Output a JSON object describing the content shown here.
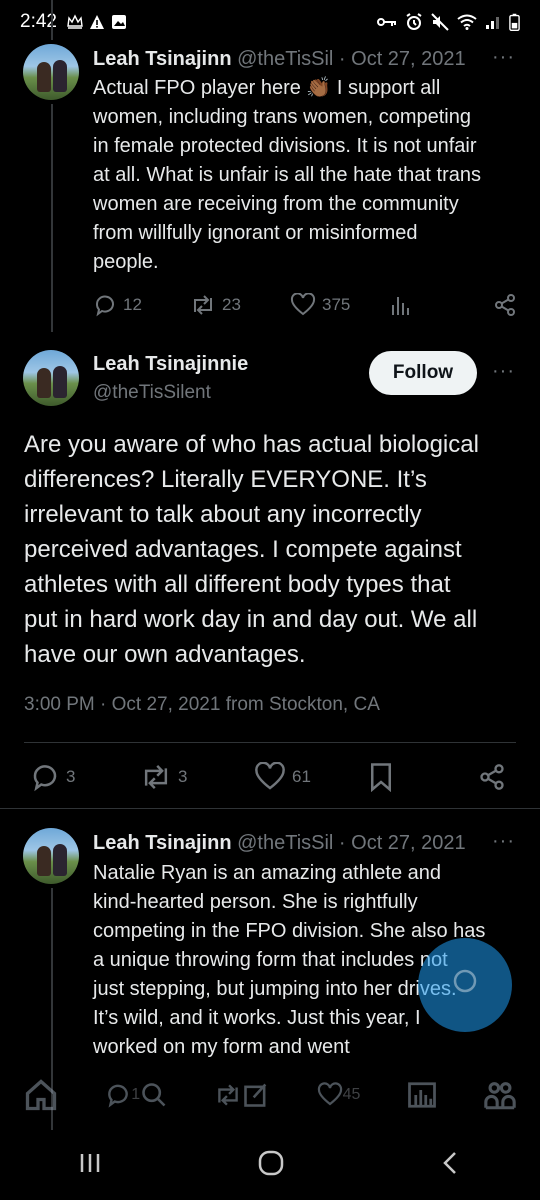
{
  "status_bar": {
    "time": "2:42",
    "left_icons": [
      "crown-icon",
      "warning-icon",
      "image-icon"
    ],
    "right_icons": [
      "key-icon",
      "alarm-icon",
      "mute-icon",
      "wifi-icon",
      "signal-icon",
      "battery-icon"
    ]
  },
  "tweet_above": {
    "name": "Leah Tsinajinn",
    "handle_date": "@theTisSil · Oct 27, 2021",
    "text_lines": [
      "Actual FPO player here 👏🏾 I support all",
      "women, including trans women, competing",
      "in female protected divisions. It is not unfair",
      "at all. What is unfair is all the hate that trans",
      "women are receiving from the community",
      "from willfully ignorant or misinformed",
      "people."
    ],
    "replies": "12",
    "reposts": "23",
    "likes": "375"
  },
  "main_tweet": {
    "name": "Leah Tsinajinnie",
    "handle": "@theTisSilent",
    "follow_label": "Follow",
    "text_lines": [
      "Are you aware of who has actual biological",
      "differences? Literally EVERYONE. It’s",
      "irrelevant to talk about any incorrectly",
      "perceived advantages. I compete against",
      "athletes with all different body types that",
      "put in hard work day in and day out. We all",
      "have our own advantages."
    ],
    "timestamp": "3:00 PM · Oct 27, 2021 from Stockton, CA",
    "replies": "3",
    "reposts": "3",
    "likes": "61"
  },
  "tweet_below": {
    "name": "Leah Tsinajinn",
    "handle_date": "@theTisSil · Oct 27, 2021",
    "text_lines": [
      "Natalie Ryan is an amazing athlete and",
      "kind-hearted person. She is rightfully",
      "competing in the FPO division. She also has",
      "a unique throwing form that includes not",
      "just stepping, but jumping into her drives.",
      "It’s wild, and it works. Just this year, I",
      "worked on my form and went"
    ],
    "overlay_replies": "1",
    "overlay_likes": "45"
  },
  "more_label": "···",
  "colors": {
    "background": "#000000",
    "text": "#e7e9ea",
    "muted": "#71767b",
    "follow_bg": "#eff3f4",
    "accent": "#1d9bf0"
  }
}
